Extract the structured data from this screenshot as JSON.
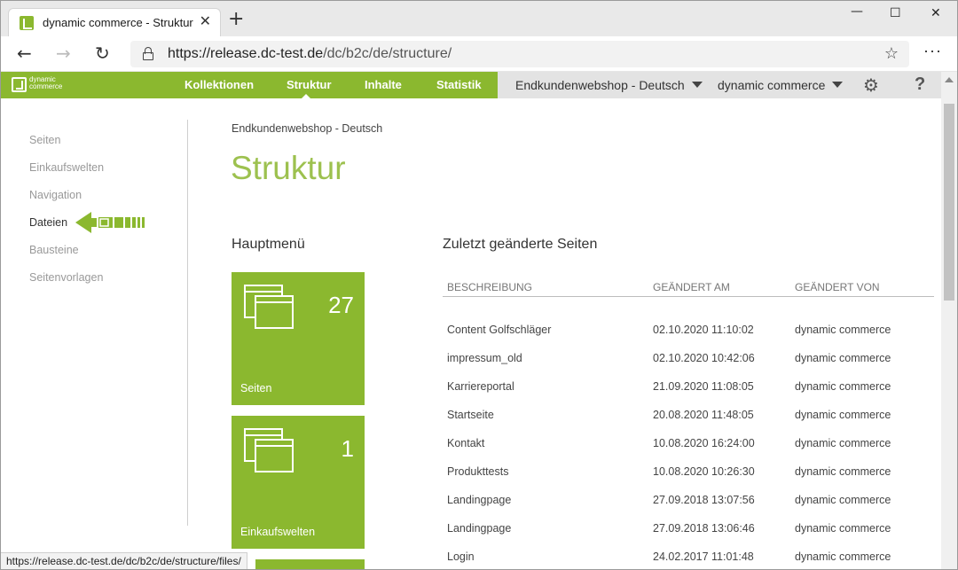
{
  "browser": {
    "tab_title": "dynamic commerce - Struktur",
    "tab_close": "✕",
    "new_tab": "+",
    "window_controls": {
      "minimize": "—",
      "maximize": "☐",
      "close": "✕"
    },
    "url_host": "https://release.dc-test.de",
    "url_path": "/dc/b2c/de/structure/",
    "back": "←",
    "forward": "→",
    "reload": "↻",
    "favorite": "☆",
    "more": "···",
    "status_url": "https://release.dc-test.de/dc/b2c/de/structure/files/"
  },
  "appnav": {
    "brand_text": "dynamic\ncommerce",
    "items": [
      {
        "label": "Kollektionen"
      },
      {
        "label": "Struktur"
      },
      {
        "label": "Inhalte"
      },
      {
        "label": "Statistik"
      }
    ],
    "shop_select": "Endkundenwebshop - Deutsch",
    "user_select": "dynamic commerce",
    "settings_icon": "⚙",
    "help_icon": "?",
    "colors": {
      "green": "#8bb82f",
      "gray": "#e3e3e3"
    }
  },
  "sidebar": {
    "items": [
      {
        "label": "Seiten"
      },
      {
        "label": "Einkaufswelten"
      },
      {
        "label": "Navigation"
      },
      {
        "label": "Dateien"
      },
      {
        "label": "Bausteine"
      },
      {
        "label": "Seitenvorlagen"
      }
    ],
    "active": "Dateien"
  },
  "main": {
    "breadcrumb": "Endkundenwebshop - Deutsch",
    "title": "Struktur",
    "hauptmenu_title": "Hauptmenü",
    "tiles": [
      {
        "count": "27",
        "label": "Seiten"
      },
      {
        "count": "1",
        "label": "Einkaufswelten"
      }
    ],
    "recent_title": "Zuletzt geänderte Seiten",
    "columns": [
      "BESCHREIBUNG",
      "GEÄNDERT AM",
      "GEÄNDERT VON"
    ],
    "rows": [
      {
        "desc": "Content Golfschläger",
        "date": "02.10.2020 11:10:02",
        "by": "dynamic commerce"
      },
      {
        "desc": "impressum_old",
        "date": "02.10.2020 10:42:06",
        "by": "dynamic commerce"
      },
      {
        "desc": "Karriereportal",
        "date": "21.09.2020 11:08:05",
        "by": "dynamic commerce"
      },
      {
        "desc": "Startseite",
        "date": "20.08.2020 11:48:05",
        "by": "dynamic commerce"
      },
      {
        "desc": "Kontakt",
        "date": "10.08.2020 16:24:00",
        "by": "dynamic commerce"
      },
      {
        "desc": "Produkttests",
        "date": "10.08.2020 10:26:30",
        "by": "dynamic commerce"
      },
      {
        "desc": "Landingpage",
        "date": "27.09.2018 13:07:56",
        "by": "dynamic commerce"
      },
      {
        "desc": "Landingpage",
        "date": "27.09.2018 13:06:46",
        "by": "dynamic commerce"
      },
      {
        "desc": "Login",
        "date": "24.02.2017 11:01:48",
        "by": "dynamic commerce"
      }
    ]
  }
}
